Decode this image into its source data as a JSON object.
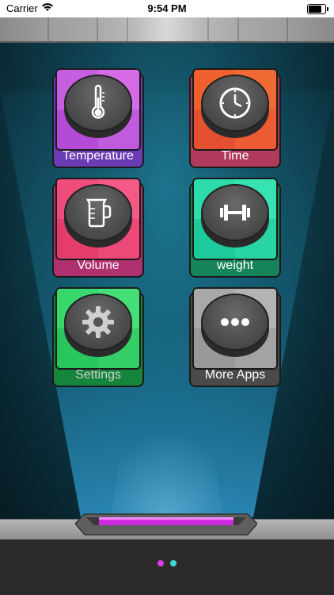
{
  "status_bar": {
    "carrier": "Carrier",
    "time": "9:54 PM"
  },
  "apps": [
    {
      "id": "temperature",
      "label": "Temperature",
      "icon": "thermometer-icon",
      "color": "#b04dcf",
      "label_color": "#ffffff"
    },
    {
      "id": "time",
      "label": "Time",
      "icon": "clock-icon",
      "color": "#e8432e",
      "label_color": "#ffffff"
    },
    {
      "id": "volume",
      "label": "Volume",
      "icon": "measuring-cup-icon",
      "color": "#e8356a",
      "label_color": "#ffffff"
    },
    {
      "id": "weight",
      "label": "weight",
      "icon": "dumbbell-icon",
      "color": "#19c49a",
      "label_color": "#ffffff"
    },
    {
      "id": "settings",
      "label": "Settings",
      "icon": "gear-icon",
      "color": "#25c25e",
      "label_color": "#d0d0d0"
    },
    {
      "id": "more_apps",
      "label": "More Apps",
      "icon": "ellipsis-icon",
      "color": "#9a9a9a",
      "label_color": "#ffffff"
    }
  ],
  "page_indicator": {
    "pages": 2,
    "active_index": 0,
    "active_color": "#e23be8",
    "inactive_color": "#43d6d6"
  },
  "colors": {
    "platform_glow": "#cf2be0"
  }
}
